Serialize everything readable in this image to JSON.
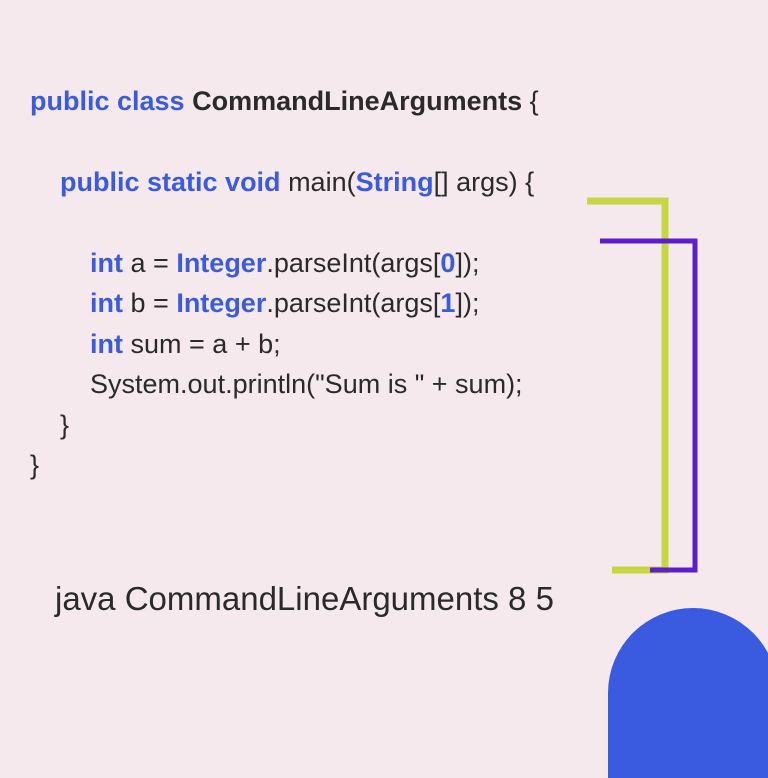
{
  "code": {
    "line1": {
      "kw1": "public class",
      "name": " CommandLineArguments ",
      "brace": "{"
    },
    "line2": {
      "indent": "    ",
      "kw": "public static void",
      "rest": " main(",
      "type": "String",
      "rest2": "[] args) {"
    },
    "line3": {
      "indent": "        ",
      "kw": "int",
      "var": " a = ",
      "type": "Integer",
      "call": ".parseInt(args[",
      "num": "0",
      "end": "]);"
    },
    "line4": {
      "indent": "        ",
      "kw": "int",
      "var": " b = ",
      "type": "Integer",
      "call": ".parseInt(args[",
      "num": "1",
      "end": "]);"
    },
    "line5": {
      "indent": "        ",
      "kw": "int",
      "rest": " sum = a + b;"
    },
    "line6": {
      "indent": "        ",
      "rest": "System.out.println(\"Sum is \" + sum);"
    },
    "line7": {
      "indent": "    ",
      "brace": "}"
    },
    "line8": {
      "brace": "}"
    }
  },
  "command": "java CommandLineArguments 8 5"
}
